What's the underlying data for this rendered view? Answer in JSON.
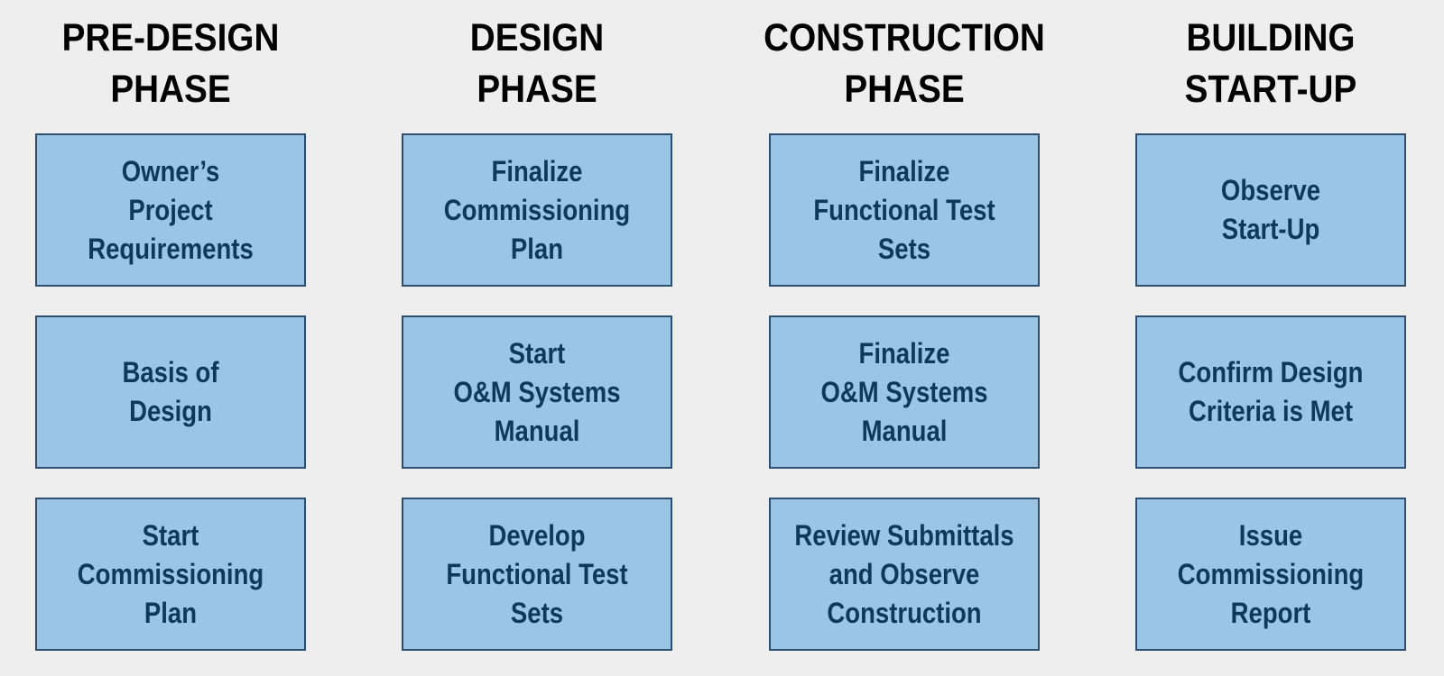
{
  "diagram": {
    "colors": {
      "background": "#eeeeee",
      "box_fill": "#9bc5e6",
      "box_border": "#2e4f6e",
      "box_text": "#0d3a5c",
      "title_text": "#000000"
    },
    "phases": [
      {
        "title": "PRE-DESIGN\nPHASE",
        "steps": [
          "Owner’s\nProject\nRequirements",
          "Basis of\nDesign",
          "Start\nCommissioning\nPlan"
        ]
      },
      {
        "title": "DESIGN\nPHASE",
        "steps": [
          "Finalize\nCommissioning\nPlan",
          "Start\nO&M Systems\nManual",
          "Develop\nFunctional Test\nSets"
        ]
      },
      {
        "title": "CONSTRUCTION\nPHASE",
        "steps": [
          "Finalize\nFunctional Test\nSets",
          "Finalize\nO&M Systems\nManual",
          "Review Submittals\nand Observe\nConstruction"
        ]
      },
      {
        "title": "BUILDING\nSTART-UP",
        "steps": [
          "Observe\nStart-Up",
          "Confirm Design\nCriteria is Met",
          "Issue\nCommissioning\nReport"
        ]
      }
    ]
  }
}
